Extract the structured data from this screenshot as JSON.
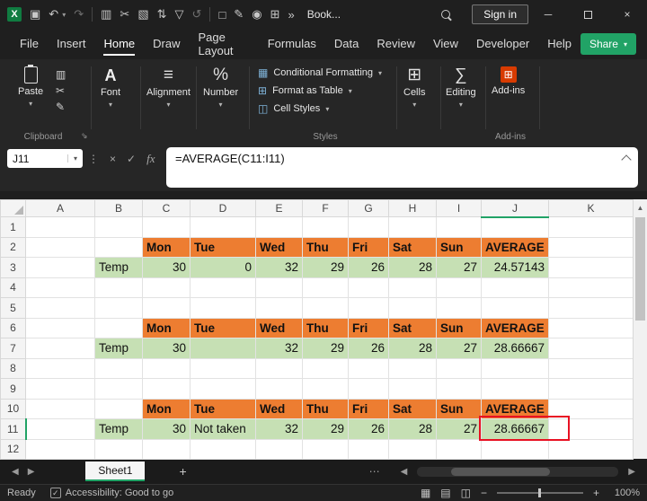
{
  "window": {
    "title": "Book...",
    "sign_in_label": "Sign in"
  },
  "icons": {
    "excel_logo": "X",
    "save": "▣",
    "undo": "↶",
    "redo": "↷",
    "copy": "▥",
    "cut": "✂",
    "image": "▧",
    "sort": "⇅",
    "filter": "▽",
    "undo_large": "↺",
    "redo_large": "↻",
    "doc": "□",
    "pen": "✎",
    "camera": "◉",
    "table": "⊞",
    "overflow": "»",
    "caret_down": "▾",
    "minimize": "─",
    "close": "×",
    "vertical_dots": "⋮",
    "cancel": "×",
    "enter": "✓",
    "fx": "fx",
    "align": "≡",
    "number": "%",
    "cf": "▦",
    "format_table": "⊞",
    "cell_styles": "◫",
    "cells": "⊞",
    "editing": "∑",
    "addins": "⊞",
    "launcher": "⇘",
    "scroll_up": "▲",
    "scroll_left": "◀",
    "scroll_right": "▶",
    "more_dots": "⋯",
    "add_sheet": "+",
    "accessibility_check": "✓",
    "view_normal": "▦",
    "view_layout": "▤",
    "view_break": "◫",
    "zoom_minus": "−",
    "zoom_plus": "+"
  },
  "menu": {
    "items": [
      "File",
      "Insert",
      "Home",
      "Draw",
      "Page Layout",
      "Formulas",
      "Data",
      "Review",
      "View",
      "Developer",
      "Help"
    ],
    "active": "Home",
    "share_label": "Share"
  },
  "ribbon": {
    "paste_label": "Paste",
    "clipboard_label": "Clipboard",
    "font_label": "Font",
    "alignment_label": "Alignment",
    "number_label": "Number",
    "conditional_formatting_label": "Conditional Formatting",
    "format_as_table_label": "Format as Table",
    "cell_styles_label": "Cell Styles",
    "styles_label": "Styles",
    "cells_label": "Cells",
    "editing_label": "Editing",
    "addins_label": "Add-ins",
    "addins_group_label": "Add-ins"
  },
  "formula_bar": {
    "name_box": "J11",
    "formula": "=AVERAGE(C11:I11)"
  },
  "sheet": {
    "columns": [
      "A",
      "B",
      "C",
      "D",
      "E",
      "F",
      "G",
      "H",
      "I",
      "J",
      "K"
    ],
    "rows": [
      "1",
      "2",
      "3",
      "4",
      "5",
      "6",
      "7",
      "8",
      "9",
      "10",
      "11",
      "12"
    ],
    "selected_cell": "J11",
    "t1": {
      "h": [
        "Mon",
        "Tue",
        "Wed",
        "Thu",
        "Fri",
        "Sat",
        "Sun",
        "AVERAGE"
      ],
      "label": "Temp",
      "v": [
        "30",
        "0",
        "32",
        "29",
        "26",
        "28",
        "27",
        "24.57143"
      ]
    },
    "t2": {
      "h": [
        "Mon",
        "Tue",
        "Wed",
        "Thu",
        "Fri",
        "Sat",
        "Sun",
        "AVERAGE"
      ],
      "label": "Temp",
      "v": [
        "30",
        "",
        "32",
        "29",
        "26",
        "28",
        "27",
        "28.66667"
      ]
    },
    "t3": {
      "h": [
        "Mon",
        "Tue",
        "Wed",
        "Thu",
        "Fri",
        "Sat",
        "Sun",
        "AVERAGE"
      ],
      "label": "Temp",
      "v": [
        "30",
        "Not taken",
        "32",
        "29",
        "26",
        "28",
        "27",
        "28.66667"
      ]
    }
  },
  "tabs": {
    "active": "Sheet1"
  },
  "status": {
    "ready": "Ready",
    "accessibility": "Accessibility: Good to go",
    "zoom": "100%"
  },
  "colors": {
    "accent_green": "#21A366",
    "header_fill": "#ED7D31",
    "data_fill": "#C6E0B4",
    "annotation_red": "#E81123",
    "selected_header": "#5A5A5A"
  }
}
